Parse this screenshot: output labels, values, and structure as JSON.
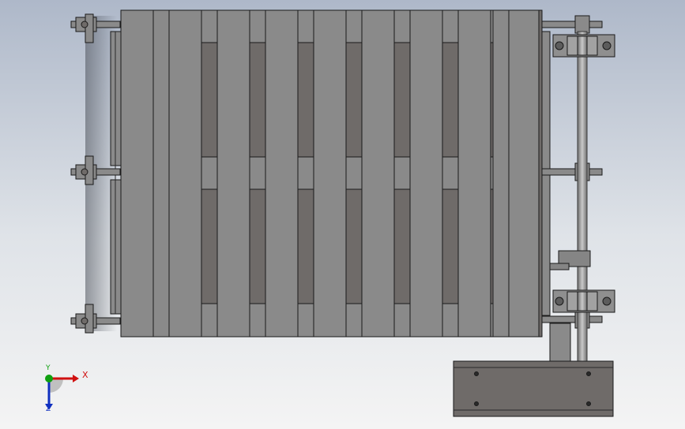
{
  "viewport": {
    "background_top": "#aeb8c9",
    "background_bottom": "#f4f4f4",
    "model_fill": "#8a8a8a",
    "model_dark": "#6f6b69",
    "model_edge": "#1a1a1a"
  },
  "triad": {
    "x_label": "X",
    "y_label": "Y",
    "z_label": "Z",
    "x_color": "#d01010",
    "y_color": "#10a010",
    "z_color": "#1030c0"
  }
}
